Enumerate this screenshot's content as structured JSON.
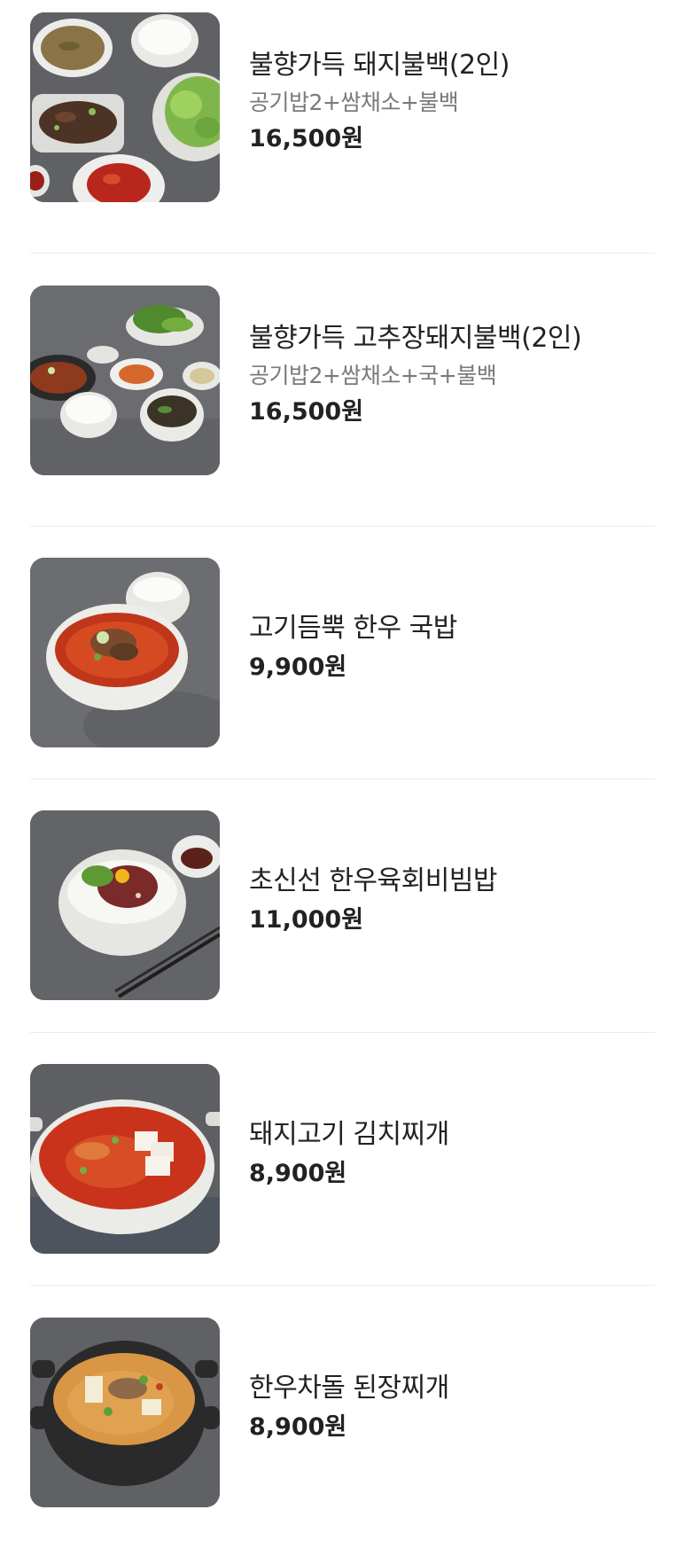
{
  "menu": {
    "items": [
      {
        "name": "불향가득 돼지불백(2인)",
        "desc": "공기밥2+쌈채소+불백",
        "price": "16,500원",
        "image": "pork-bulbaek-set-photo"
      },
      {
        "name": "불향가득 고추장돼지불백(2인)",
        "desc": "공기밥2+쌈채소+국+불백",
        "price": "16,500원",
        "image": "gochujang-pork-bulbaek-set-photo"
      },
      {
        "name": "고기듬뿍 한우 국밥",
        "desc": "",
        "price": "9,900원",
        "image": "hanwoo-gukbap-photo"
      },
      {
        "name": "초신선 한우육회비빔밥",
        "desc": "",
        "price": "11,000원",
        "image": "hanwoo-yukhoe-bibimbap-photo"
      },
      {
        "name": "돼지고기 김치찌개",
        "desc": "",
        "price": "8,900원",
        "image": "pork-kimchi-jjigae-photo"
      },
      {
        "name": "한우차돌 된장찌개",
        "desc": "",
        "price": "8,900원",
        "image": "hanwoo-chadol-doenjang-jjigae-photo"
      }
    ]
  }
}
